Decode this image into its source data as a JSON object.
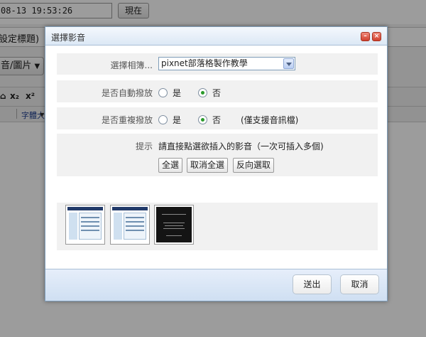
{
  "background": {
    "datetime_value": "08-13 19:53:26",
    "now_button": "現在",
    "title_hint": "設定標題)",
    "media_button": "音/圖片",
    "toolbar_glyphs": [
      "⌂",
      "x₂",
      "x²"
    ],
    "font_label": "字體大"
  },
  "dialog": {
    "title": "選擇影音",
    "minimize_icon": "minimize-icon",
    "close_icon": "close-icon",
    "album": {
      "label": "選擇相簿...",
      "selected": "pixnet部落格製作教學"
    },
    "autoplay": {
      "label": "是否自動撥放",
      "yes": "是",
      "no": "否",
      "selected": "no"
    },
    "repeat": {
      "label": "是否重複撥放",
      "yes": "是",
      "no": "否",
      "note": "(僅支援音訊檔)",
      "selected": "no"
    },
    "hint": {
      "label": "提示",
      "text": "請直接點選欲插入的影音（一次可插入多個)",
      "select_all": "全選",
      "deselect_all": "取消全選",
      "invert_selection": "反向選取"
    },
    "thumbnails": [
      {
        "kind": "screenshot"
      },
      {
        "kind": "screenshot"
      },
      {
        "kind": "dark-title-card"
      }
    ],
    "footer": {
      "submit": "送出",
      "cancel": "取消"
    }
  },
  "colors": {
    "dialog_border": "#7f9db9",
    "titlebar_top": "#f4f8fd",
    "titlebar_bottom": "#dce8f5",
    "row_background": "#f1f1f1",
    "radio_checked": "#2a9a2a",
    "window_button": "#d0402e"
  }
}
